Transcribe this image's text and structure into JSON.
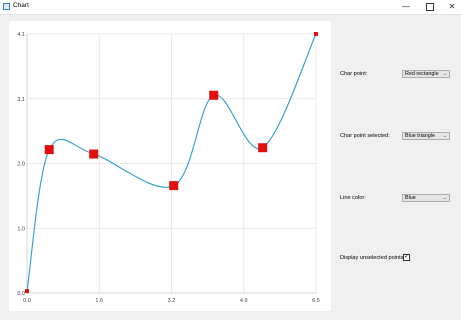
{
  "window": {
    "title": "Chart",
    "minimize_glyph": "—",
    "close_glyph": "✕"
  },
  "controls": {
    "char_point_label": "Char point:",
    "char_point_value": "Red rectangle",
    "char_point_selected_label": "Char point selected:",
    "char_point_selected_value": "Blue triangle",
    "line_color_label": "Line color:",
    "line_color_value": "Blue",
    "display_unselected_label": "Display unselected points:",
    "display_unselected_checked": true,
    "check_glyph": "✓",
    "dropdown_glyph": "⌄"
  },
  "chart_data": {
    "type": "line",
    "smooth": true,
    "x_ticks": [
      "0.0",
      "1.6",
      "3.2",
      "4.9",
      "6.5"
    ],
    "y_ticks": [
      "0.0",
      "1.0",
      "2.0",
      "3.1",
      "4.1"
    ],
    "xlim": [
      0,
      6.5
    ],
    "ylim": [
      0,
      4.1
    ],
    "grid": true,
    "line_color": "#2e9bd3",
    "marker_color": "#e0100c",
    "points": [
      {
        "x": 0.0,
        "y": 0.03
      },
      {
        "x": 0.5,
        "y": 2.27
      },
      {
        "x": 1.5,
        "y": 2.2
      },
      {
        "x": 3.3,
        "y": 1.7
      },
      {
        "x": 4.2,
        "y": 3.13
      },
      {
        "x": 5.3,
        "y": 2.3
      },
      {
        "x": 6.5,
        "y": 4.1
      }
    ]
  }
}
